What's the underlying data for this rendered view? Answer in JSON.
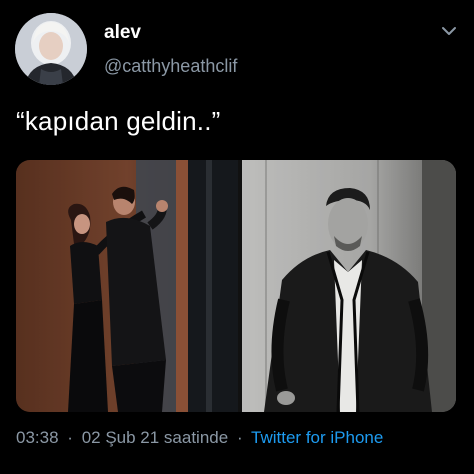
{
  "user": {
    "display_name": "alev",
    "handle": "@catthyheathclif",
    "avatar_icon": "profile-avatar"
  },
  "menu": {
    "icon": "chevron-down-icon"
  },
  "tweet": {
    "text": "“kapıdan geldin..”"
  },
  "media": {
    "images": [
      {
        "description_icon": "photo-couple-embrace"
      },
      {
        "description_icon": "photo-man-in-coat"
      }
    ]
  },
  "meta": {
    "time": "03:38",
    "separator": "·",
    "date": "02 Şub 21 saatinde",
    "separator2": "·",
    "source": "Twitter for iPhone"
  },
  "colors": {
    "background": "#000000",
    "text_primary": "#ffffff",
    "text_secondary": "#8b98a5",
    "link": "#1d9bf0"
  }
}
